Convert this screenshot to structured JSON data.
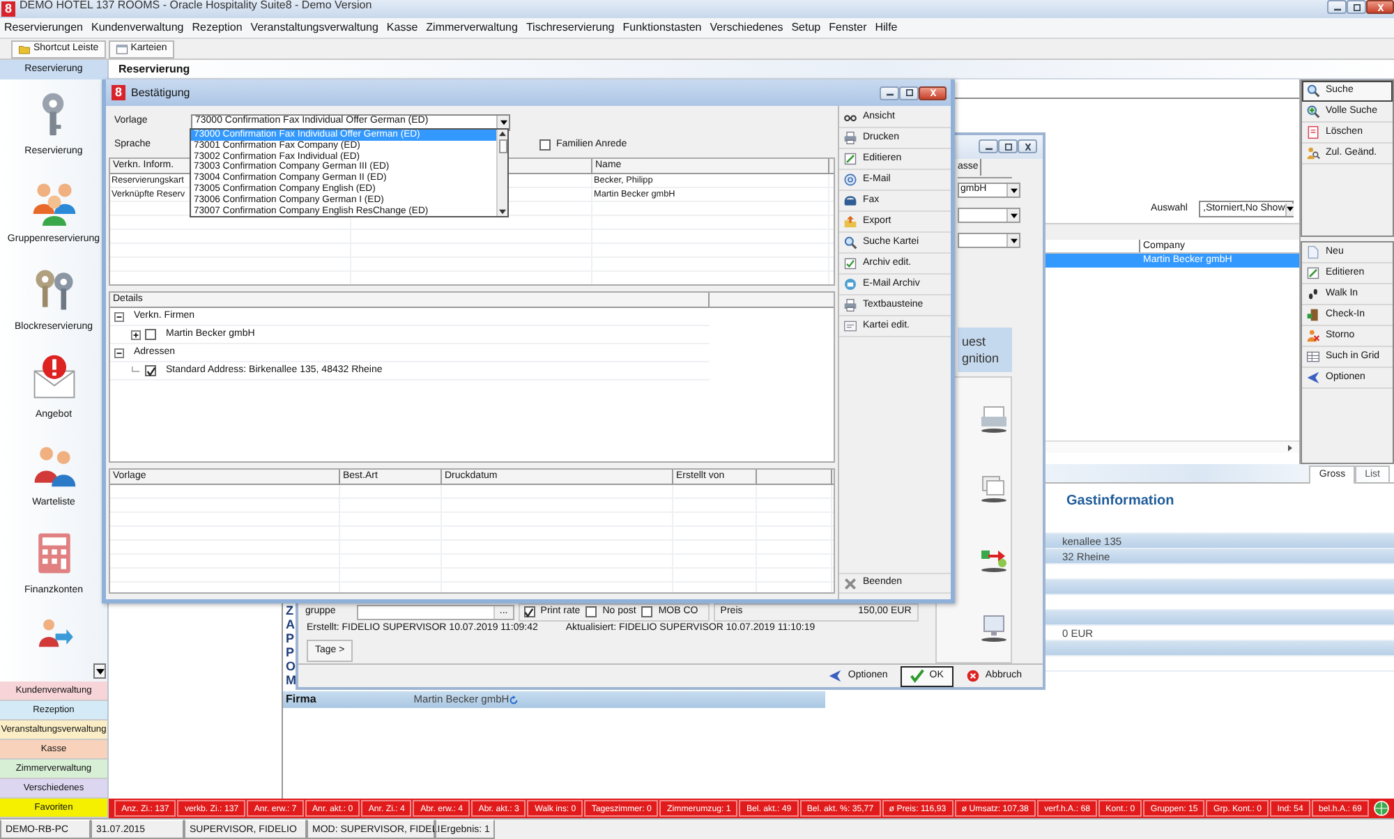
{
  "window": {
    "logo": "8",
    "title": "DEMO HOTEL 137 ROOMS - Oracle Hospitality Suite8 - Demo Version"
  },
  "menu": [
    "Reservierungen",
    "Kundenverwaltung",
    "Rezeption",
    "Veranstaltungsverwaltung",
    "Kasse",
    "Zimmerverwaltung",
    "Tischreservierung",
    "Funktionstasten",
    "Verschiedenes",
    "Setup",
    "Fenster",
    "Hilfe"
  ],
  "toolbar": [
    "Shortcut Leiste",
    "Karteien"
  ],
  "sidebar": {
    "header": "Reservierung",
    "items": [
      "Reservierung",
      "Gruppenreservierung",
      "Blockreservierung",
      "Angebot",
      "Warteliste",
      "Finanzkonten"
    ],
    "modules": [
      {
        "label": "Kundenverwaltung",
        "color": "#f7d4d7"
      },
      {
        "label": "Rezeption",
        "color": "#d4ebf7"
      },
      {
        "label": "Veranstaltungsverwaltung",
        "color": "#fbeec6"
      },
      {
        "label": "Kasse",
        "color": "#f8d2ba"
      },
      {
        "label": "Zimmerverwaltung",
        "color": "#d6efd5"
      },
      {
        "label": "Verschiedenes",
        "color": "#ddd6f0"
      },
      {
        "label": "Favoriten",
        "color": "#f4f000"
      }
    ]
  },
  "main": {
    "header": "Reservierung",
    "filter": {
      "label": "Auswahl",
      "value": ",Storniert,No Show"
    },
    "grid": {
      "columns": [
        "Company"
      ],
      "rows": [
        {
          "company": "Martin Becker gmbH",
          "selected": true
        }
      ]
    },
    "search_buttons": [
      "Suche",
      "Volle Suche",
      "Löschen",
      "Zul. Geänd."
    ],
    "action_buttons": [
      "Neu",
      "Editieren",
      "Walk In",
      "Check-In",
      "Storno",
      "Such in Grid",
      "Optionen"
    ],
    "view_tabs": [
      {
        "label": "Gross",
        "selected": true
      },
      {
        "label": "List",
        "selected": false
      }
    ],
    "guest_title": "Gastinformation",
    "guest_rows": [
      {
        "shaded": false
      },
      {
        "text": "kenallee 135",
        "shaded": true
      },
      {
        "text": "32 Rheine",
        "shaded": true
      },
      {
        "shaded": false
      },
      {
        "shaded": true
      },
      {
        "shaded": false
      },
      {
        "shaded": true
      },
      {
        "text": "0 EUR",
        "shaded": false
      },
      {
        "shaded": true
      },
      {
        "shaded": false
      }
    ],
    "side_letters": [
      "Z",
      "A",
      "P",
      "P",
      "O",
      "M"
    ],
    "firma": {
      "label": "Firma",
      "value": "Martin Becker gmbH"
    }
  },
  "reservation_window": {
    "tab": "asse",
    "combos": [
      "gmbH"
    ],
    "recognition_title": [
      "uest",
      "gnition"
    ],
    "group_label": "gruppe",
    "field_button": "...",
    "checks": [
      {
        "label": "Print rate",
        "checked": true
      },
      {
        "label": "No post",
        "checked": false
      },
      {
        "label": "MOB CO",
        "checked": false
      }
    ],
    "price_label": "Preis",
    "price": "150,00 EUR",
    "created": "Erstellt: FIDELIO SUPERVISOR 10.07.2019 11:09:42",
    "updated": "Aktualisiert: FIDELIO SUPERVISOR 10.07.2019 11:10:19",
    "days_button": "Tage >",
    "buttons": [
      {
        "label": "Optionen",
        "kind": "options",
        "focused": false
      },
      {
        "label": "OK",
        "kind": "ok",
        "focused": true
      },
      {
        "label": "Abbruch",
        "kind": "cancel",
        "focused": false
      }
    ]
  },
  "dialog": {
    "logo": "8",
    "title": "Bestätigung",
    "template_label": "Vorlage",
    "template_value": "73000 Confirmation Fax Individual Offer German (ED)",
    "template_options": [
      {
        "label": "73000 Confirmation Fax Individual Offer German (ED)",
        "selected": true
      },
      {
        "label": "73001 Confirmation Fax Company (ED)",
        "selected": false
      },
      {
        "label": "73002 Confirmation Fax Individual (ED)",
        "selected": false
      },
      {
        "label": "73003 Confirmation Company German III (ED)",
        "selected": false
      },
      {
        "label": "73004 Confirmation Company German II (ED)",
        "selected": false
      },
      {
        "label": "73005 Confirmation Company English (ED)",
        "selected": false
      },
      {
        "label": "73006 Confirmation Company German I (ED)",
        "selected": false
      },
      {
        "label": "73007 Confirmation Company English ResChange (ED)",
        "selected": false
      }
    ],
    "language_label": "Sprache",
    "family_salutation": {
      "label": "Familien Anrede",
      "checked": false
    },
    "links": {
      "columns": [
        "Verkn. Inform.",
        "Name"
      ],
      "rows": [
        {
          "info": "Reservierungskart",
          "name": "Becker, Philipp"
        },
        {
          "info": "Verknüpfte Reserv",
          "name": "Martin Becker gmbH"
        }
      ]
    },
    "details": {
      "title": "Details",
      "tree": [
        {
          "label": "Verkn. Firmen",
          "expanded": true,
          "children": [
            {
              "label": "Martin Becker gmbH",
              "expanded": false,
              "checked": false
            }
          ]
        },
        {
          "label": "Adressen",
          "expanded": true,
          "children": [
            {
              "label": "Standard Address: Birkenallee 135, 48432 Rheine",
              "checked": true
            }
          ]
        }
      ]
    },
    "history": {
      "columns": [
        "Vorlage",
        "Best.Art",
        "Druckdatum",
        "Erstellt von"
      ]
    },
    "buttons": [
      "Ansicht",
      "Drucken",
      "Editieren",
      "E-Mail",
      "Fax",
      "Export",
      "Suche Kartei",
      "Archiv edit.",
      "E-Mail Archiv",
      "Textbausteine",
      "Kartei edit."
    ],
    "close_button": "Beenden"
  },
  "stats": [
    "Anz. Zi.: 137",
    "verkb. Zi.: 137",
    "Anr. erw.: 7",
    "Anr. akt.: 0",
    "Anr. Zi.: 4",
    "Abr. erw.: 4",
    "Abr. akt.: 3",
    "Walk ins: 0",
    "Tageszimmer: 0",
    "Zimmerumzug: 1",
    "Bel. akt.: 49",
    "Bel. akt. %: 35,77",
    "ø Preis: 116,93",
    "ø Umsatz: 107,38",
    "verf.h.A.: 68",
    "Kont.: 0",
    "Gruppen: 15",
    "Grp. Kont.: 0",
    "Ind: 54",
    "bel.h.A.: 69"
  ],
  "status_bar": [
    "DEMO-RB-PC",
    "31.07.2015",
    "SUPERVISOR, FIDELIO",
    "MOD: SUPERVISOR, FIDELI",
    "Ergebnis: 1"
  ]
}
